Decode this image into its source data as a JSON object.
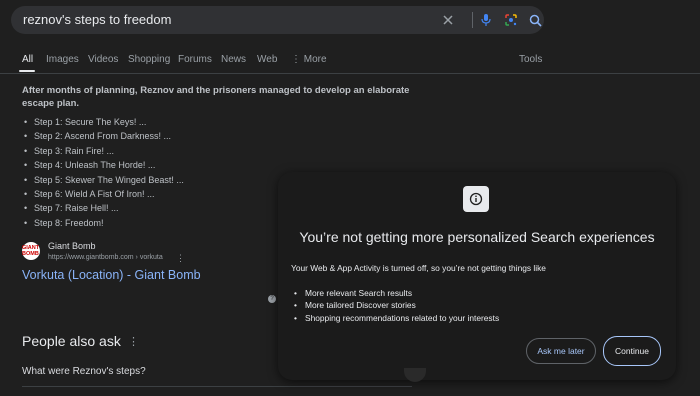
{
  "search": {
    "query": "reznov's steps to freedom",
    "icons": [
      "clear-icon",
      "mic-icon",
      "lens-icon",
      "search-icon"
    ]
  },
  "tabs": [
    {
      "label": "All",
      "active": true
    },
    {
      "label": "Images"
    },
    {
      "label": "Videos"
    },
    {
      "label": "Shopping"
    },
    {
      "label": "Forums"
    },
    {
      "label": "News"
    },
    {
      "label": "Web"
    },
    {
      "label": "⋮ More"
    },
    {
      "label": "Tools"
    }
  ],
  "snippet": {
    "heading": "After months of planning, Reznov and the prisoners managed to develop an elaborate escape plan.",
    "bullet": "•",
    "steps": [
      "Step 1: Secure The Keys! ...",
      "Step 2: Ascend From Darkness! ...",
      "Step 3: Rain Fire! ...",
      "Step 4: Unleash The Horde! ...",
      "Step 5: Skewer The Winged Beast! ...",
      "Step 6: Wield A Fist Of Iron! ...",
      "Step 7: Raise Hell! ...",
      "Step 8: Freedom!"
    ]
  },
  "result": {
    "favicon_text": "GIANT BOMB",
    "source_name": "Giant Bomb",
    "source_url": "https://www.giantbomb.com › vorkuta",
    "menu_glyph": "⋮",
    "title": "Vorkuta (Location) - Giant Bomb"
  },
  "help_glyph": "?",
  "people_also_ask": {
    "title": "People also ask",
    "menu_glyph": "⋮",
    "questions": [
      "What were Reznov's steps?"
    ]
  },
  "dialog": {
    "icon": "info-icon",
    "title": "You’re not getting more personalized Search experiences",
    "body": "Your Web & App Activity is turned off, so you’re not getting things like",
    "bullet": "•",
    "items": [
      "More relevant Search results",
      "More tailored Discover stories",
      "Shopping recommendations related to your interests"
    ],
    "ask_later_label": "Ask me later",
    "continue_label": "Continue"
  },
  "colors": {
    "background": "#1f1f1f",
    "link": "#8ab4f8",
    "accent": "#a8c7fa"
  }
}
